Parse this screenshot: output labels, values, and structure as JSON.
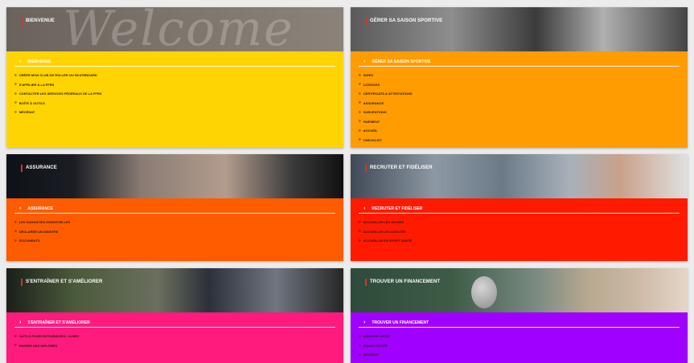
{
  "colors": {
    "yellow": "#ffd400",
    "orange": "#ff9c00",
    "deep_orange": "#ff5c00",
    "red": "#ff1a00",
    "pink": "#ff1a7e",
    "purple": "#a000ff",
    "accent_bar": "#e0301e"
  },
  "cards": [
    {
      "hero_title": "BIENVENUE",
      "hero_deco": "Welcome",
      "section_title": "BIENVENUE",
      "items": [
        "CRÉER MON CLUB DE ROLLER OU SKATEBOARD",
        "S'AFFILIER À LA FFRS",
        "CONTACTER LES SERVICES FÉDÉRAUX DE LA FFRS",
        "BOÎTE À OUTILS",
        "MÉCÉNAT"
      ]
    },
    {
      "hero_title": "GÉRER SA SAISON SPORTIVE",
      "section_title": "GÉRER SA SAISON SPORTIVE",
      "items": [
        "SIGES",
        "LICENCES",
        "CERTIFICATS & ATTESTATIONS",
        "ASSURANCE",
        "SUBVENTIONS",
        "PAIEMENT",
        "ACCUEIL",
        "CHECKLIST"
      ]
    },
    {
      "hero_title": "ASSURANCE",
      "section_title": "ASSURANCE",
      "items": [
        "LES GARANTIES ESSENTIELLES",
        "DÉCLARER UN SINISTRE",
        "DOCUMENTS"
      ]
    },
    {
      "hero_title": "RECRUTER ET FIDÉLISER",
      "section_title": "RECRUTER ET FIDÉLISER",
      "items": [
        "ACCUEILLIR LES JEUNES",
        "ACCUEILLIR LES ADULTES",
        "ACCUEILLIR EN SPORT SANTÉ"
      ]
    },
    {
      "hero_title": "S'ENTRAÎNER ET S'AMÉLIORER",
      "section_title": "S'ENTRAÎNER ET S'AMÉLIORER",
      "items": [
        "OUTILS POUR ENTRAÎNEURS / JUGES",
        "PASSER DES DIPLÔMES"
      ]
    },
    {
      "hero_title": "TROUVER UN FINANCEMENT",
      "section_title": "TROUVER UN FINANCEMENT",
      "items": [
        "AIDES DE L'ÉTAT",
        "FONDS PRIVÉS",
        "MÉCÉNAT"
      ]
    }
  ]
}
